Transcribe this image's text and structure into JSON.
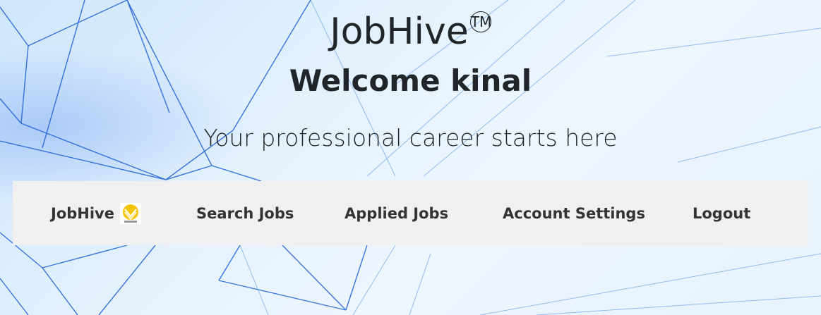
{
  "header": {
    "brand_title": "JobHive",
    "trademark": "TM",
    "welcome": "Welcome kinal",
    "tagline": "Your professional career starts here"
  },
  "navbar": {
    "brand_label": "JobHive",
    "items": [
      {
        "label": "Search Jobs"
      },
      {
        "label": "Applied Jobs"
      },
      {
        "label": "Account Settings"
      },
      {
        "label": "Logout"
      }
    ]
  },
  "colors": {
    "navbar_bg": "#f1f0f0",
    "text": "#212529",
    "logo_yellow": "#f5c400",
    "network_lines": "#1a5fd6"
  },
  "icons": {
    "brand_logo": "jobhive-logo-icon"
  }
}
